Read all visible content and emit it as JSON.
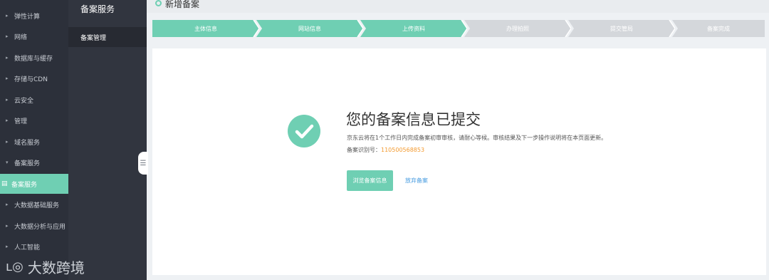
{
  "colors": {
    "accent": "#6fcfb3",
    "nav_bg": "#2c303a",
    "subnav_bg": "#31353f",
    "step_pending": "#d4d7db",
    "record_number": "#f39a2f",
    "link": "#4a9de0"
  },
  "nav": {
    "items": [
      {
        "label": "弹性计算",
        "icon": "caret-right-icon"
      },
      {
        "label": "网络",
        "icon": "caret-right-icon"
      },
      {
        "label": "数据库与缓存",
        "icon": "caret-right-icon"
      },
      {
        "label": "存储与CDN",
        "icon": "caret-right-icon"
      },
      {
        "label": "云安全",
        "icon": "caret-right-icon"
      },
      {
        "label": "管理",
        "icon": "caret-right-icon"
      },
      {
        "label": "域名服务",
        "icon": "caret-right-icon"
      },
      {
        "label": "备案服务",
        "icon": "caret-down-icon"
      },
      {
        "label": "备案服务",
        "icon": "record-icon",
        "active": true
      },
      {
        "label": "大数据基础服务",
        "icon": "caret-right-icon"
      },
      {
        "label": "大数据分析与应用",
        "icon": "caret-right-icon"
      },
      {
        "label": "人工智能",
        "icon": "caret-right-icon"
      }
    ]
  },
  "subnav": {
    "title": "备案服务",
    "item": "备案管理"
  },
  "header": {
    "title": "新增备案"
  },
  "steps": [
    {
      "label": "主体信息",
      "done": true
    },
    {
      "label": "网站信息",
      "done": true
    },
    {
      "label": "上传资料",
      "done": true
    },
    {
      "label": "办理拍照",
      "done": false
    },
    {
      "label": "提交管局",
      "done": false
    },
    {
      "label": "备案完成",
      "done": false
    }
  ],
  "content": {
    "headline": "您的备案信息已提交",
    "description": "京东云将在1个工作日内完成备案初审审核，请耐心等候。审核结果及下一步操作说明将在本页面更新。",
    "record_label": "备案识别号：",
    "record_number": "110500568853",
    "view_button": "浏览备案信息",
    "abandon_link": "放弃备案"
  },
  "watermark": {
    "text": "大数跨境"
  }
}
